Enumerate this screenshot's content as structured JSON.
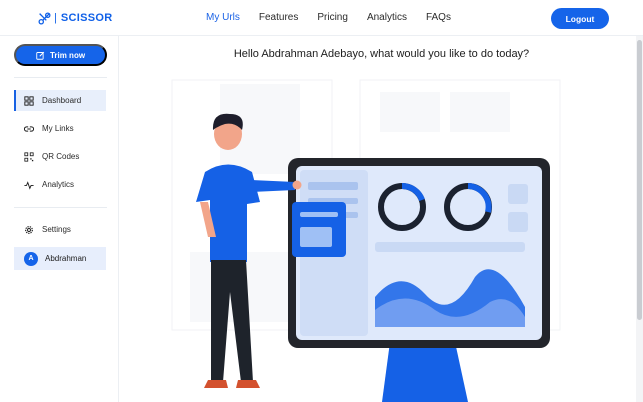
{
  "header": {
    "brand": "SCISSOR",
    "nav": [
      {
        "label": "My Urls",
        "active": true
      },
      {
        "label": "Features",
        "active": false
      },
      {
        "label": "Pricing",
        "active": false
      },
      {
        "label": "Analytics",
        "active": false
      },
      {
        "label": "FAQs",
        "active": false
      }
    ],
    "logout_label": "Logout"
  },
  "sidebar": {
    "trim_label": "Trim now",
    "items": [
      {
        "label": "Dashboard",
        "icon": "grid-icon",
        "active": true
      },
      {
        "label": "My Links",
        "icon": "link-icon",
        "active": false
      },
      {
        "label": "QR Codes",
        "icon": "qr-code-icon",
        "active": false
      },
      {
        "label": "Analytics",
        "icon": "pulse-icon",
        "active": false
      }
    ],
    "settings_label": "Settings",
    "profile": {
      "initial": "A",
      "name": "Abdrahman"
    }
  },
  "main": {
    "greeting": "Hello Abdrahman Adebayo, what would you like to do today?"
  },
  "colors": {
    "accent": "#1564e9",
    "active_bg": "#e8effb",
    "text": "#1b1b1b"
  }
}
